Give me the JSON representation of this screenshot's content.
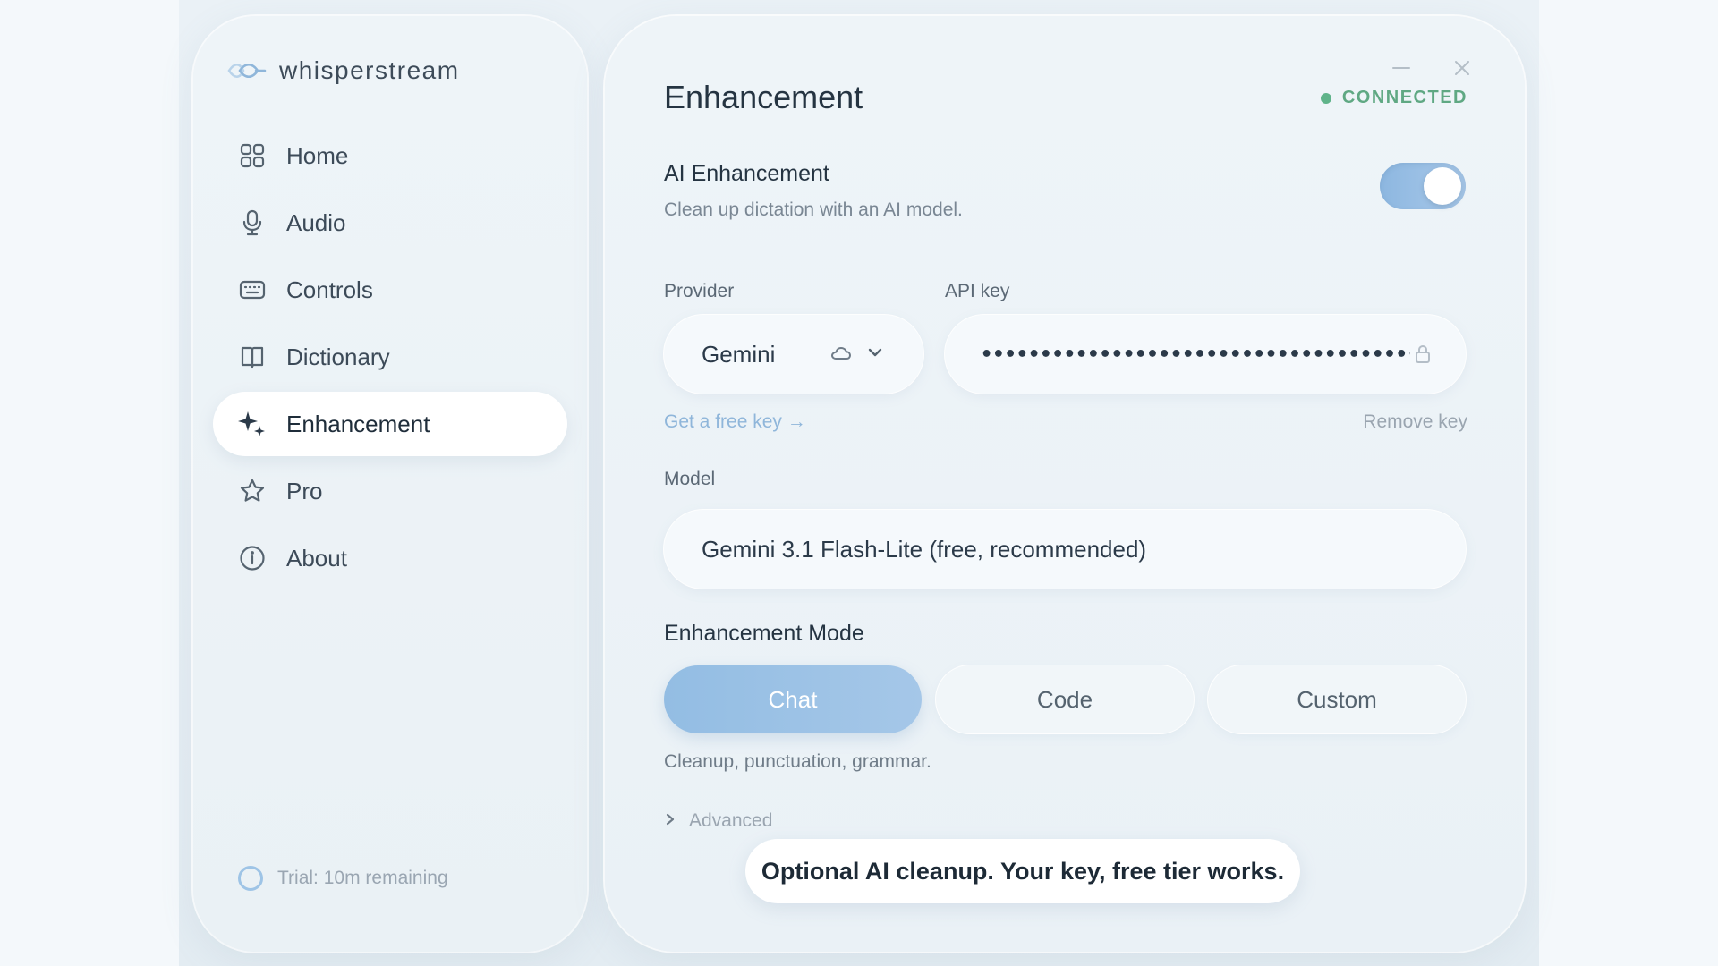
{
  "app": {
    "brand_name": "whisperstream"
  },
  "sidebar": {
    "items": [
      {
        "label": "Home",
        "icon": "grid-icon"
      },
      {
        "label": "Audio",
        "icon": "microphone-icon"
      },
      {
        "label": "Controls",
        "icon": "keyboard-icon"
      },
      {
        "label": "Dictionary",
        "icon": "book-icon"
      },
      {
        "label": "Enhancement",
        "icon": "sparkles-icon",
        "active": true
      },
      {
        "label": "Pro",
        "icon": "star-icon"
      },
      {
        "label": "About",
        "icon": "info-icon"
      }
    ],
    "trial_text": "Trial: 10m remaining"
  },
  "main": {
    "title": "Enhancement",
    "status": "CONNECTED",
    "ai_enhancement": {
      "title": "AI Enhancement",
      "description": "Clean up dictation with an AI model.",
      "enabled": true
    },
    "provider": {
      "label": "Provider",
      "value": "Gemini"
    },
    "api_key": {
      "label": "API key",
      "value": "•••••••••••••••••••••••••••••••••••••••••••••••"
    },
    "get_free_key": "Get a free key →",
    "remove_key": "Remove key",
    "model": {
      "label": "Model",
      "value": "Gemini 3.1 Flash-Lite (free, recommended)"
    },
    "mode": {
      "title": "Enhancement Mode",
      "options": [
        "Chat",
        "Code",
        "Custom"
      ],
      "selected": "Chat",
      "description": "Cleanup, punctuation, grammar."
    },
    "advanced_label": "Advanced"
  },
  "caption": "Optional AI cleanup. Your key, free tier works.",
  "colors": {
    "accent": "#9cc2e6",
    "status_green": "#5fb38a",
    "link_blue": "#8fb6da"
  }
}
